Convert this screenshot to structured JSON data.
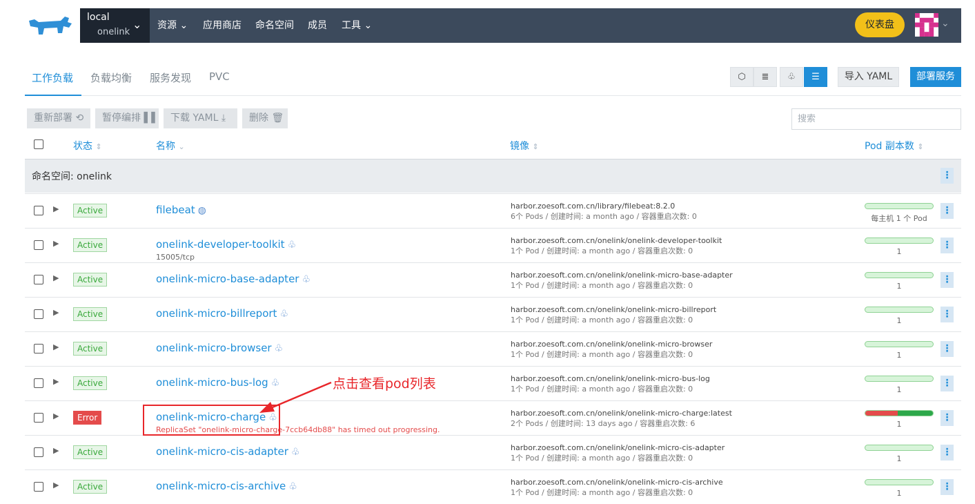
{
  "header": {
    "cluster_name": "local",
    "project_name": "onelink",
    "nav_resources": "资源",
    "nav_appstore": "应用商店",
    "nav_namespaces": "命名空间",
    "nav_members": "成员",
    "nav_tools": "工具",
    "dashboard_button": "仪表盘",
    "brand_color": "#3c4a5c"
  },
  "tabs": {
    "workloads": "工作负载",
    "load_balancing": "负载均衡",
    "service_discovery": "服务发现",
    "pvc": "PVC"
  },
  "toolbar": {
    "import_yaml": "导入 YAML",
    "deploy": "部署服务"
  },
  "bulk": {
    "redeploy": "重新部署",
    "pause": "暂停编排",
    "download_yaml": "下载 YAML",
    "delete": "删除"
  },
  "search": {
    "placeholder": "搜索"
  },
  "table": {
    "col_state": "状态",
    "col_name": "名称",
    "col_image": "镜像",
    "col_scale": "Pod 副本数",
    "group_label": "命名空间: onelink",
    "rows": [
      {
        "state": "Active",
        "name": "filebeat",
        "sub": "",
        "image": "harbor.zoesoft.com.cn/library/filebeat:8.2.0",
        "meta": "6个 Pods / 创建时间: a month ago / 容器重启次数: 0",
        "scale": "每主机 1 个 Pod"
      },
      {
        "state": "Active",
        "name": "onelink-developer-toolkit",
        "sub": "15005/tcp",
        "image": "harbor.zoesoft.com.cn/onelink/onelink-developer-toolkit",
        "meta": "1个 Pod / 创建时间: a month ago / 容器重启次数: 0",
        "scale": "1"
      },
      {
        "state": "Active",
        "name": "onelink-micro-base-adapter",
        "sub": "",
        "image": "harbor.zoesoft.com.cn/onelink/onelink-micro-base-adapter",
        "meta": "1个 Pod / 创建时间: a month ago / 容器重启次数: 0",
        "scale": "1"
      },
      {
        "state": "Active",
        "name": "onelink-micro-billreport",
        "sub": "",
        "image": "harbor.zoesoft.com.cn/onelink/onelink-micro-billreport",
        "meta": "1个 Pod / 创建时间: a month ago / 容器重启次数: 0",
        "scale": "1"
      },
      {
        "state": "Active",
        "name": "onelink-micro-browser",
        "sub": "",
        "image": "harbor.zoesoft.com.cn/onelink/onelink-micro-browser",
        "meta": "1个 Pod / 创建时间: a month ago / 容器重启次数: 0",
        "scale": "1"
      },
      {
        "state": "Active",
        "name": "onelink-micro-bus-log",
        "sub": "",
        "image": "harbor.zoesoft.com.cn/onelink/onelink-micro-bus-log",
        "meta": "1个 Pod / 创建时间: a month ago / 容器重启次数: 0",
        "scale": "1"
      },
      {
        "state": "Error",
        "name": "onelink-micro-charge",
        "sub": "ReplicaSet \"onelink-micro-charge-7ccb64db88\" has timed out progressing.",
        "image": "harbor.zoesoft.com.cn/onelink/onelink-micro-charge:latest",
        "meta": "2个 Pods / 创建时间: 13 days ago / 容器重启次数: 6",
        "scale": "1"
      },
      {
        "state": "Active",
        "name": "onelink-micro-cis-adapter",
        "sub": "",
        "image": "harbor.zoesoft.com.cn/onelink/onelink-micro-cis-adapter",
        "meta": "1个 Pod / 创建时间: a month ago / 容器重启次数: 0",
        "scale": "1"
      },
      {
        "state": "Active",
        "name": "onelink-micro-cis-archive",
        "sub": "",
        "image": "harbor.zoesoft.com.cn/onelink/onelink-micro-cis-archive",
        "meta": "1个 Pod / 创建时间: a month ago / 容器重启次数: 0",
        "scale": "1"
      }
    ]
  },
  "annotation": {
    "text": "点击查看pod列表"
  }
}
